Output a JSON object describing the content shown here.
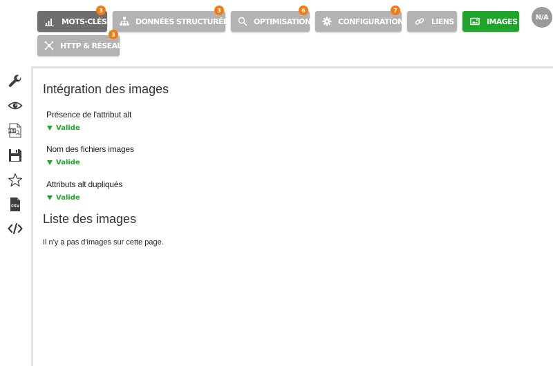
{
  "tabs": [
    {
      "label": "MOTS-CLÉS",
      "badge": "3",
      "icon": "bar-chart-icon",
      "state": "dark"
    },
    {
      "label": "DONNÉES STRUCTURÉES",
      "badge": "3",
      "icon": "sitemap-icon",
      "state": "normal"
    },
    {
      "label": "OPTIMISATION",
      "badge": "6",
      "icon": "search-icon",
      "state": "normal"
    },
    {
      "label": "CONFIGURATION",
      "badge": "7",
      "icon": "gear-icon",
      "state": "normal"
    },
    {
      "label": "LIENS",
      "icon": "link-icon",
      "state": "normal"
    },
    {
      "label": "IMAGES",
      "icon": "image-icon",
      "state": "active"
    },
    {
      "label": "HTTP & RÉSEAU",
      "badge": "3",
      "icon": "network-icon",
      "state": "normal"
    }
  ],
  "avatar": "N/A",
  "sidebar": [
    "wrench-icon",
    "eye-icon",
    "pdf-icon",
    "save-icon",
    "star-icon",
    "csv-icon",
    "code-icon"
  ],
  "main": {
    "section1_title": "Intégration des images",
    "checks": [
      {
        "label": "Présence de l'attribut alt",
        "status": "Valide"
      },
      {
        "label": "Nom des fichiers images",
        "status": "Valide"
      },
      {
        "label": "Attributs alt dupliqués",
        "status": "Valide"
      }
    ],
    "section2_title": "Liste des images",
    "empty_message": "Il n'y a pas d'images sur cette page."
  },
  "colors": {
    "active_tab": "#1fa52b",
    "badge": "#f07c14",
    "tab": "#b3b3b3",
    "tab_dark": "#6e6e6e",
    "valid": "#1fa52b"
  }
}
